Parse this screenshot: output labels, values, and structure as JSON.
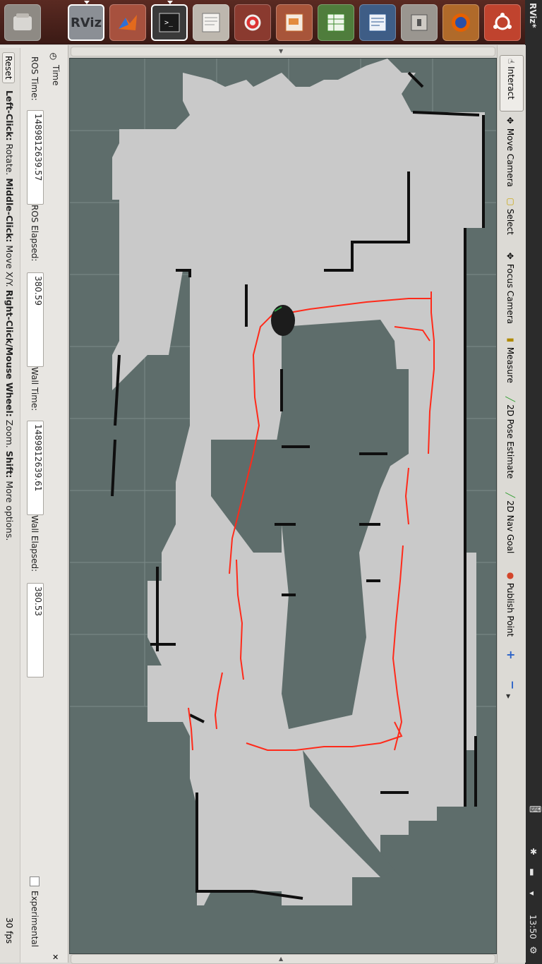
{
  "window": {
    "title": "RViz*"
  },
  "panel": {
    "clock": "13:50"
  },
  "launcher": {
    "items": [
      {
        "name": "files-icon",
        "label": ""
      },
      {
        "name": "rviz-icon",
        "label": "RViz"
      },
      {
        "name": "matlab-icon",
        "label": ""
      },
      {
        "name": "terminal-icon",
        "label": ""
      },
      {
        "name": "text-editor-icon",
        "label": ""
      },
      {
        "name": "system-settings-icon",
        "label": ""
      },
      {
        "name": "presentation-icon",
        "label": ""
      },
      {
        "name": "spreadsheet-icon",
        "label": ""
      },
      {
        "name": "writer-icon",
        "label": ""
      },
      {
        "name": "window-icon",
        "label": ""
      },
      {
        "name": "firefox-icon",
        "label": ""
      },
      {
        "name": "ubuntu-icon",
        "label": ""
      }
    ]
  },
  "toolbar": {
    "interact": "Interact",
    "move_camera": "Move Camera",
    "select": "Select",
    "focus_camera": "Focus Camera",
    "measure": "Measure",
    "pose_estimate": "2D Pose Estimate",
    "nav_goal": "2D Nav Goal",
    "publish_point": "Publish Point",
    "plus": "+",
    "minus": "−"
  },
  "time": {
    "title": "Time",
    "ros_time_label": "ROS Time:",
    "ros_time": "1489812639.57",
    "ros_elapsed_label": "ROS Elapsed:",
    "ros_elapsed": "380.59",
    "wall_time_label": "Wall Time:",
    "wall_time": "1489812639.61",
    "wall_elapsed_label": "Wall Elapsed:",
    "wall_elapsed": "380.53",
    "experimental": "Experimental"
  },
  "status": {
    "reset": "Reset",
    "help_left": "Left-Click:",
    "help_left_val": " Rotate. ",
    "help_middle": "Middle-Click:",
    "help_middle_val": " Move X/Y. ",
    "help_right": "Right-Click/Mouse Wheel:",
    "help_right_val": " Zoom. ",
    "help_shift": "Shift:",
    "help_shift_val": " More options.",
    "fps": "30 fps"
  },
  "colors": {
    "map_unknown": "#5e6d6b",
    "map_free": "#c9c9c9",
    "map_wall": "#111111",
    "path": "#ff2a1a"
  }
}
